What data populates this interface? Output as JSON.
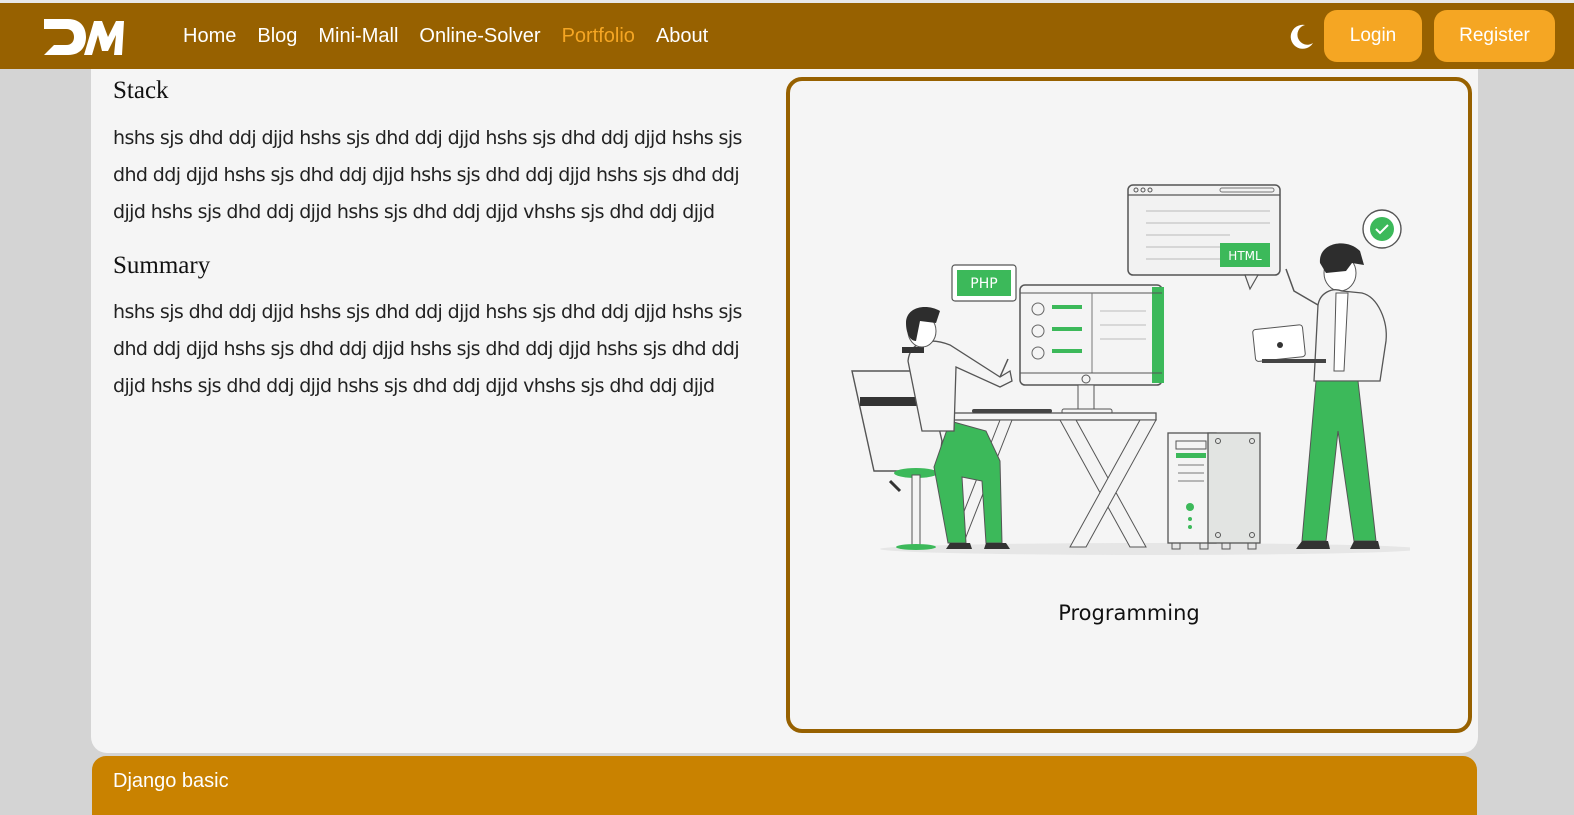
{
  "nav": {
    "links": [
      "Home",
      "Blog",
      "Mini-Mall",
      "Online-Solver",
      "Portfolio",
      "About"
    ],
    "active": "Portfolio",
    "login_label": "Login",
    "register_label": "Register"
  },
  "content": {
    "stack_heading": "Stack",
    "stack_text": "hshs sjs dhd ddj djjd hshs sjs dhd ddj djjd hshs sjs dhd ddj djjd hshs sjs dhd ddj djjd hshs sjs dhd ddj djjd hshs sjs dhd ddj djjd hshs sjs dhd ddj djjd hshs sjs dhd ddj djjd hshs sjs dhd ddj djjd vhshs sjs dhd ddj djjd",
    "summary_heading": "Summary",
    "summary_text": "hshs sjs dhd ddj djjd hshs sjs dhd ddj djjd hshs sjs dhd ddj djjd hshs sjs dhd ddj djjd hshs sjs dhd ddj djjd hshs sjs dhd ddj djjd hshs sjs dhd ddj djjd hshs sjs dhd ddj djjd hshs sjs dhd ddj djjd vhshs sjs dhd ddj djjd"
  },
  "portfolio_item": {
    "caption": "Programming",
    "bubble_php": "PHP",
    "bubble_html": "HTML"
  },
  "footer": {
    "title": "Django basic"
  },
  "colors": {
    "navbar": "#976100",
    "accent": "#f5a623",
    "footer": "#c98200",
    "illustration_green": "#3cb95a"
  }
}
